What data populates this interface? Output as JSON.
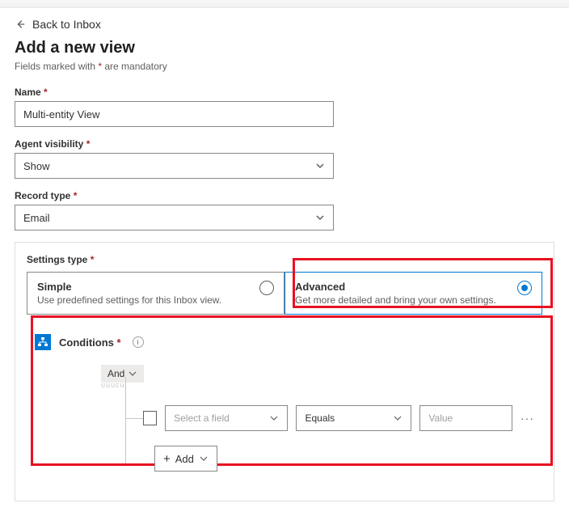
{
  "back_link": "Back to Inbox",
  "title": "Add a new view",
  "mandatory_note_prefix": "Fields marked with ",
  "mandatory_note_suffix": " are mandatory",
  "asterisk": "*",
  "fields": {
    "name": {
      "label": "Name",
      "value": "Multi-entity View"
    },
    "agent_visibility": {
      "label": "Agent visibility",
      "value": "Show"
    },
    "record_type": {
      "label": "Record type",
      "value": "Email"
    }
  },
  "settings_type": {
    "label": "Settings type",
    "options": {
      "simple": {
        "title": "Simple",
        "desc": "Use predefined settings for this Inbox view.",
        "selected": false
      },
      "advanced": {
        "title": "Advanced",
        "desc": "Get more detailed and bring your own settings.",
        "selected": true
      }
    }
  },
  "conditions": {
    "title": "Conditions",
    "logic": "And",
    "row": {
      "field_placeholder": "Select a field",
      "operator": "Equals",
      "value_placeholder": "Value"
    },
    "add_label": "Add",
    "more": "···"
  }
}
